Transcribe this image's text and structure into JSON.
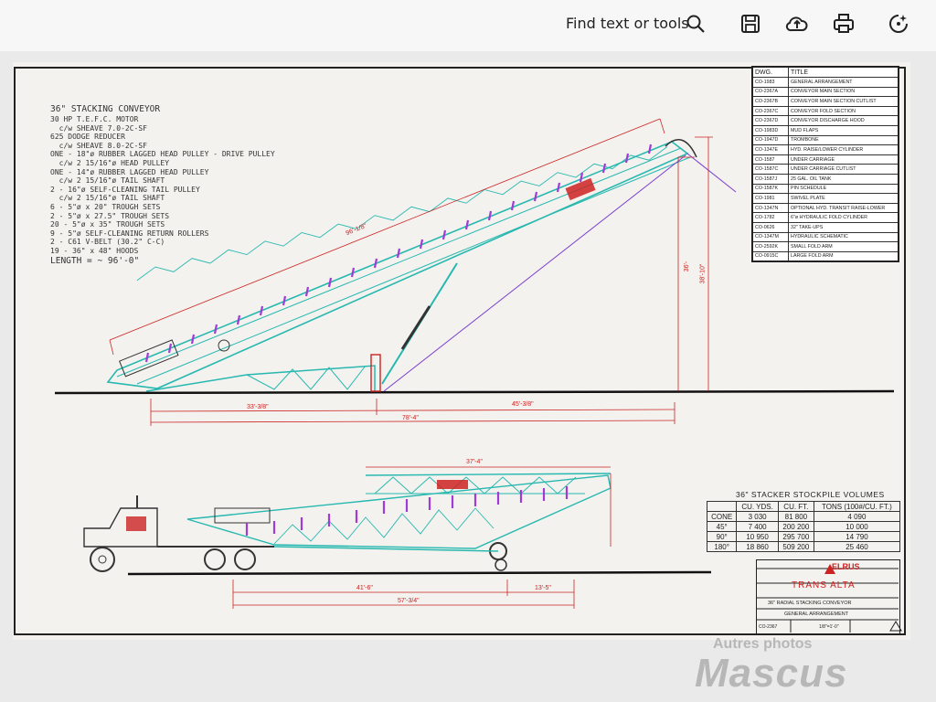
{
  "toolbar": {
    "find_label": "Find text or tools",
    "icons": [
      "search-icon",
      "save-icon",
      "share-icon",
      "print-icon",
      "ai-assistant-icon"
    ]
  },
  "notes": {
    "title": "36\" STACKING CONVEYOR",
    "lines": [
      "30 HP T.E.F.C. MOTOR",
      "  c/w SHEAVE 7.0-2C-SF",
      "625 DODGE REDUCER",
      "  c/w SHEAVE 8.0-2C-SF",
      "ONE - 18\"ø RUBBER LAGGED HEAD PULLEY - DRIVE PULLEY",
      "  c/w 2 15/16\"ø HEAD PULLEY",
      "ONE - 14\"ø RUBBER LAGGED HEAD PULLEY",
      "  c/w 2 15/16\"ø TAIL SHAFT",
      "2 - 16\"ø SELF-CLEANING TAIL PULLEY",
      "  c/w 2 15/16\"ø TAIL SHAFT",
      "6 - 5\"ø x 20\" TROUGH SETS",
      "2 - 5\"ø x 27.5\" TROUGH SETS",
      "20 - 5\"ø x 35\" TROUGH SETS",
      "9 - 5\"ø SELF-CLEANING RETURN ROLLERS",
      "2 - C61 V-BELT (30.2\" C-C)",
      "19 - 36\" x 48\" HOODS"
    ],
    "length": "LENGTH = ~ 96'-0\""
  },
  "dwg_table": {
    "headers": [
      "DWG.",
      "TITLE"
    ],
    "rows": [
      [
        "CO-1983",
        "GENERAL ARRANGEMENT"
      ],
      [
        "CO-2367A",
        "CONVEYOR MAIN SECTION"
      ],
      [
        "CO-2367B",
        "CONVEYOR MAIN SECTION CUTLIST"
      ],
      [
        "CO-2367C",
        "CONVEYOR FOLD SECTION"
      ],
      [
        "CO-2367D",
        "CONVEYOR DISCHARGE HOOD"
      ],
      [
        "CO-1983D",
        "MUD FLAPS"
      ],
      [
        "CO-1947D",
        "TROMBONE"
      ],
      [
        "CO-1347E",
        "HYD. RAISE/LOWER CYLINDER"
      ],
      [
        "CO-1587",
        "UNDER CARRIAGE"
      ],
      [
        "CO-1587C",
        "UNDER CARRIAGE CUTLIST"
      ],
      [
        "CO-1587J",
        "25 GAL. OIL TANK"
      ],
      [
        "CO-1587K",
        "PIN SCHEDULE"
      ],
      [
        "CO-1981",
        "SWIVEL PLATE"
      ],
      [
        "CO-1347N",
        "OPTIONAL HYD. TRANSIT RAISE-LOWER"
      ],
      [
        "CO-1782",
        "6\"ø HYDRAULIC FOLD CYLINDER"
      ],
      [
        "CO-0626",
        "32\" TAKE-UPS"
      ],
      [
        "CO-1347M",
        "HYDRAULIC SCHEMATIC"
      ],
      [
        "CO-2592K",
        "SMALL FOLD ARM"
      ],
      [
        "CO-0915C",
        "LARGE FOLD ARM"
      ]
    ]
  },
  "volumes": {
    "title": "36\" STACKER STOCKPILE VOLUMES",
    "headers": [
      "",
      "CU. YDS.",
      "CU. FT.",
      "TONS (100#/CU. FT.)"
    ],
    "rows": [
      [
        "CONE",
        "3 030",
        "81 800",
        "4 090"
      ],
      [
        "45°",
        "7 400",
        "200 200",
        "10 000"
      ],
      [
        "90°",
        "10 950",
        "295 700",
        "14 790"
      ],
      [
        "180°",
        "18 860",
        "509 200",
        "25 460"
      ]
    ]
  },
  "title_block": {
    "logo": "ELRUS",
    "client": "TRANS ALTA",
    "project": "36\" RADIAL STACKING CONVEYOR",
    "description": "GENERAL ARRANGEMENT",
    "drawing_no": "CO-2367",
    "scale": "1/8\"=1'-0\""
  },
  "dimensions": {
    "boom_length": "96'-1/8\"",
    "base_left": "33'-3/8\"",
    "base_right": "45'-3/8\"",
    "base_total": "78'-4\"",
    "height_left": "36'-",
    "height_right": "38'-10\"",
    "transport_top": "37'-4\"",
    "transport_a": "41'-6\"",
    "transport_b": "13'-5\"",
    "transport_total": "57'-3/4\""
  },
  "colors": {
    "frame": "#27b8b0",
    "idlers": "#a23bd6",
    "dims": "#cc2222",
    "stockpile_line": "#7b3fd0",
    "ink": "#222222"
  },
  "watermark": {
    "small": "Autres photos",
    "big": "Mascus"
  }
}
